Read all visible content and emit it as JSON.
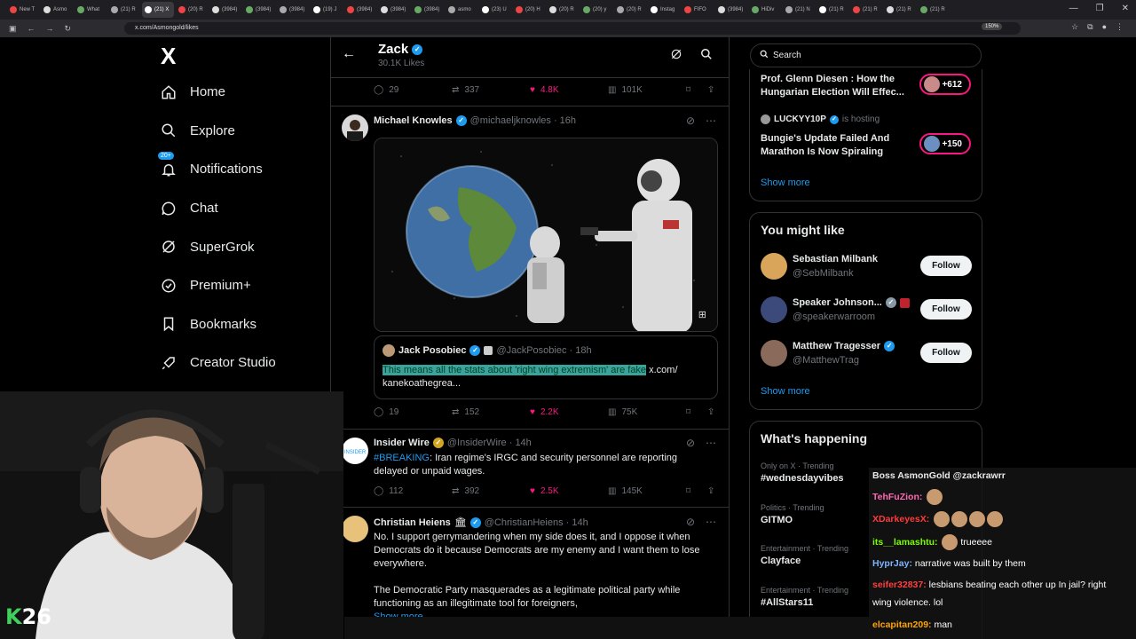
{
  "browser": {
    "tabs": [
      "New T",
      "Asmo",
      "What",
      "(21) R",
      "(21) X",
      "(20) R",
      "(3984)",
      "(3984)",
      "(3984)",
      "(19) J",
      "(3984)",
      "(3984)",
      "(3984)",
      "asmo",
      "(23) U",
      "(20) H",
      "(20) R",
      "(20) y",
      "(20) R",
      "Instag",
      "FIFO",
      "(3984)",
      "HiDiv",
      "(21) N",
      "(21) R",
      "(21) R",
      "(21) R",
      "(21) R"
    ],
    "url": "x.com/Asmongold/likes",
    "zoom": "150%"
  },
  "nav": {
    "logo": "X",
    "items": [
      {
        "label": "Home",
        "icon": "home-icon"
      },
      {
        "label": "Explore",
        "icon": "search-icon"
      },
      {
        "label": "Notifications",
        "icon": "bell-icon",
        "badge": "20+"
      },
      {
        "label": "Chat",
        "icon": "chat-icon"
      },
      {
        "label": "SuperGrok",
        "icon": "grok-icon"
      },
      {
        "label": "Premium+",
        "icon": "premium-icon"
      },
      {
        "label": "Bookmarks",
        "icon": "bookmark-icon"
      },
      {
        "label": "Creator Studio",
        "icon": "rocket-icon"
      }
    ]
  },
  "header": {
    "name": "Zack",
    "sub": "30.1K Likes"
  },
  "tweets": [
    {
      "id": "prev",
      "replies": "29",
      "retweets": "337",
      "likes": "4.8K",
      "views": "101K"
    },
    {
      "id": "knowles",
      "name": "Michael Knowles",
      "handle": "@michaeljknowles · 16h",
      "quote": {
        "name": "Jack Posobiec",
        "handle": "@JackPosobiec · 18h",
        "highlight": "This means all the stats about 'right wing extremism' are fake",
        "rest": " x.com/",
        "line2": "kanekoathegrea..."
      },
      "replies": "19",
      "retweets": "152",
      "likes": "2.2K",
      "views": "75K"
    },
    {
      "id": "insider",
      "name": "Insider Wire",
      "handle": "@InsiderWire · 14h",
      "tag": "#BREAKING",
      "text": ": Iran regime's IRGC and security personnel are reporting",
      "line2": "delayed or unpaid wages.",
      "replies": "112",
      "retweets": "392",
      "likes": "2.5K",
      "views": "145K"
    },
    {
      "id": "heiens",
      "name": "Christian Heiens",
      "handle": "@ChristianHeiens · 14h",
      "para1": [
        "No. I support gerrymandering when my side does it, and I oppose it when",
        "Democrats do it because Democrats are my enemy and I want them to lose",
        "everywhere."
      ],
      "para2": [
        "The Democratic Party masquerades as a legitimate political party while",
        "functioning as an illegitimate tool for foreigners,"
      ],
      "show_more": "Show more"
    }
  ],
  "right": {
    "search_placeholder": "Search",
    "live": [
      {
        "title": "Prof. Glenn Diesen : How the Hungarian Election Will Effec...",
        "count": "+612"
      },
      {
        "host": "LUCKYY10P",
        "host_suffix": "is hosting",
        "title": "Bungie's Update Failed And Marathon Is Now Spiraling",
        "count": "+150"
      }
    ],
    "show_more": "Show more",
    "might_like_title": "You might like",
    "might_like": [
      {
        "name": "Sebastian Milbank",
        "handle": "@SebMilbank",
        "button": "Follow"
      },
      {
        "name": "Speaker Johnson...",
        "handle": "@speakerwarroom",
        "button": "Follow"
      },
      {
        "name": "Matthew Tragesser",
        "handle": "@MatthewTrag",
        "button": "Follow"
      }
    ],
    "happening_title": "What's happening",
    "trends": [
      {
        "cat": "Only on X · Trending",
        "name": "#wednesdayvibes"
      },
      {
        "cat": "Politics · Trending",
        "name": "GITMO"
      },
      {
        "cat": "Entertainment · Trending",
        "name": "Clayface"
      },
      {
        "cat": "Entertainment · Trending",
        "name": "#AllStars11"
      }
    ]
  },
  "overlay": {
    "k_letter": "K",
    "k_number": "26",
    "chat": [
      {
        "user": "Boss AsmonGold @zackrawrr",
        "msg": "",
        "color": "#e7e9ea"
      },
      {
        "user": "TehFuZion:",
        "msg": "",
        "color": "#ff69b4",
        "emotes": 1
      },
      {
        "user": "XDarkeyesX:",
        "msg": "",
        "color": "#ff3b3b",
        "emotes": 4
      },
      {
        "user": "its__lamashtu:",
        "msg": "trueeee",
        "color": "#7cfc00",
        "emotes": 1
      },
      {
        "user": "HyprJay:",
        "msg": "narrative was built by them",
        "color": "#7fb3ff"
      },
      {
        "user": "seifer32837:",
        "msg": "lesbians beating each other up In jail? right",
        "color": "#ff4040"
      },
      {
        "user": "",
        "msg": "wing violence. lol",
        "color": "#ffffff"
      },
      {
        "user": "elcapitan209:",
        "msg": "man",
        "color": "#ffa500"
      }
    ]
  }
}
